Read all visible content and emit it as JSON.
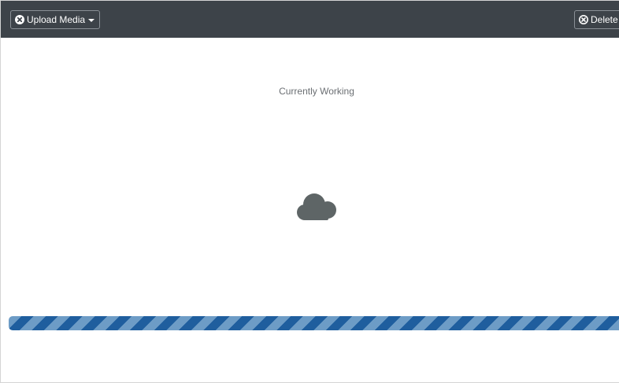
{
  "toolbar": {
    "upload_label": "Upload Media",
    "delete_label": "Delete",
    "upload_icon": "upload-icon",
    "delete_icon": "delete-icon",
    "caret_icon": "chevron-down-icon"
  },
  "main": {
    "status_text": "Currently Working",
    "status_icon": "cloud-icon"
  },
  "progress": {
    "state": "indeterminate",
    "value": 1.0
  },
  "colors": {
    "toolbar_bg": "#3d4349",
    "progress_dark": "#1f5e9e",
    "progress_light": "#6d9cc6",
    "cloud": "#5e6566",
    "status_text": "#6b6f73"
  }
}
